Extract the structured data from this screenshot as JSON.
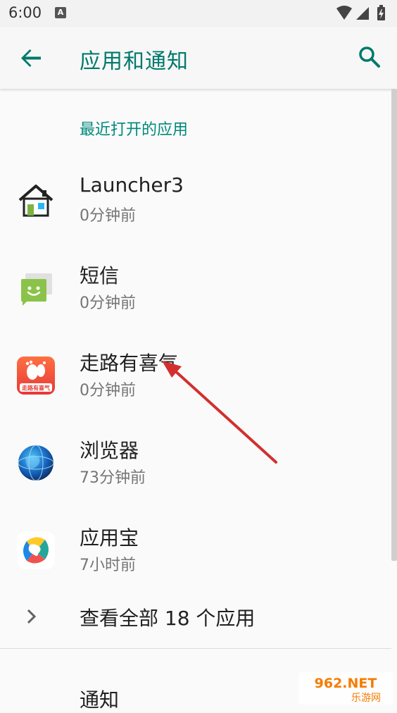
{
  "status_bar": {
    "time": "6:00",
    "notification_icon": "A"
  },
  "app_bar": {
    "title": "应用和通知",
    "back_icon": "arrow-back-icon",
    "search_icon": "search-icon"
  },
  "recent_apps": {
    "header": "最近打开的应用",
    "items": [
      {
        "name": "Launcher3",
        "time": "0分钟前",
        "icon": "launcher-house-icon"
      },
      {
        "name": "短信",
        "time": "0分钟前",
        "icon": "messaging-icon"
      },
      {
        "name": "走路有喜气",
        "time": "0分钟前",
        "icon": "walking-app-icon",
        "icon_text": "走路有喜气"
      },
      {
        "name": "浏览器",
        "time": "73分钟前",
        "icon": "browser-globe-icon"
      },
      {
        "name": "应用宝",
        "time": "7小时前",
        "icon": "appstore-icon"
      }
    ]
  },
  "see_all": {
    "label": "查看全部 18 个应用"
  },
  "notifications": {
    "label": "通知"
  },
  "watermark": {
    "brand": "962.NET",
    "subtitle": "乐游网"
  },
  "colors": {
    "accent": "#00796b",
    "section_header": "#00897b",
    "annotation_arrow": "#d32f2f"
  }
}
